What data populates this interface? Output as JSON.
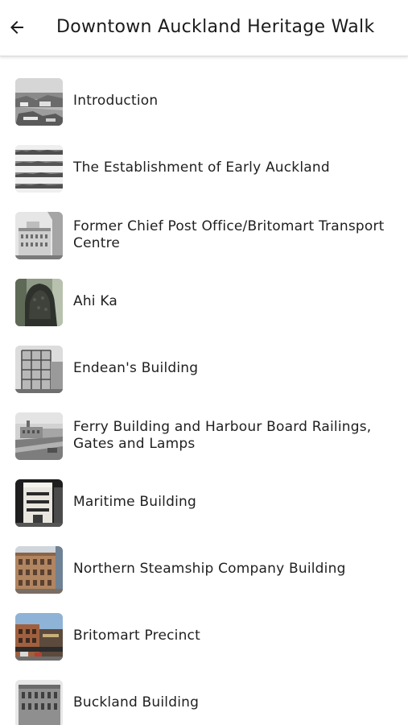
{
  "header": {
    "title": "Downtown Auckland Heritage Walk",
    "back_icon": "arrow-left-icon"
  },
  "stops": [
    {
      "label": "Introduction",
      "thumb": "harbour-photo-bw"
    },
    {
      "label": "The Establishment of Early Auckland",
      "thumb": "panorama-strips-bw"
    },
    {
      "label": "Former Chief Post Office/Britomart Transport Centre",
      "thumb": "post-office-building-bw"
    },
    {
      "label": "Ahi Ka",
      "thumb": "ahi-ka-sculpture"
    },
    {
      "label": "Endean's Building",
      "thumb": "endeans-building-bw"
    },
    {
      "label": "Ferry Building and Harbour Board Railings, Gates and Lamps",
      "thumb": "ferry-building-bw"
    },
    {
      "label": "Maritime Building",
      "thumb": "maritime-building"
    },
    {
      "label": "Northern Steamship Company Building",
      "thumb": "northern-steamship-building"
    },
    {
      "label": "Britomart Precinct",
      "thumb": "britomart-precinct"
    },
    {
      "label": "Buckland Building",
      "thumb": "buckland-building"
    }
  ],
  "colors": {
    "text": "#1f1f1f",
    "divider": "#d9d9d9",
    "background": "#ffffff"
  }
}
